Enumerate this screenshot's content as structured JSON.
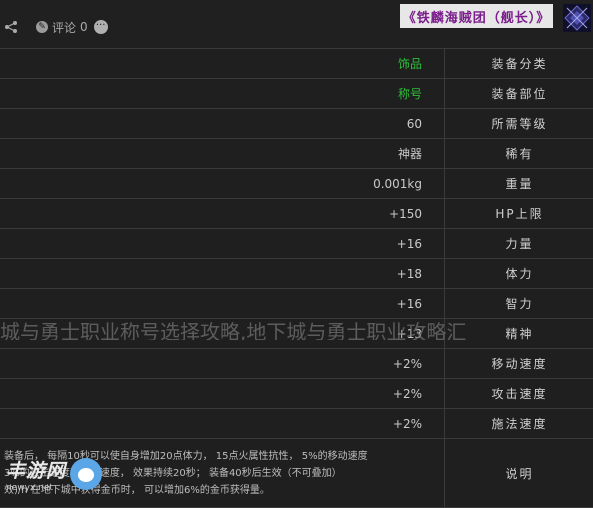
{
  "header": {
    "title": "《铁麟海贼团（舰长）》",
    "comment_label": "评论",
    "comment_count": "0"
  },
  "rows": [
    {
      "label": "装备分类",
      "value": "饰品",
      "value_color": "green"
    },
    {
      "label": "装备部位",
      "value": "称号",
      "value_color": "green"
    },
    {
      "label": "所需等级",
      "value": "60"
    },
    {
      "label": "稀有",
      "value": "神器"
    },
    {
      "label": "重量",
      "value": "0.001kg"
    },
    {
      "label": "HP上限",
      "value": "+150"
    },
    {
      "label": "力量",
      "value": "+16"
    },
    {
      "label": "体力",
      "value": "+18"
    },
    {
      "label": "智力",
      "value": "+16"
    },
    {
      "label": "精神",
      "value": "+13"
    },
    {
      "label": "移动速度",
      "value": "+2%"
    },
    {
      "label": "攻击速度",
      "value": "+2%"
    },
    {
      "label": "施法速度",
      "value": "+2%"
    }
  ],
  "description": {
    "label": "说明",
    "text": "装备后，  每隔10秒可以使自身增加20点体力，  15点火属性抗性，  5%的移动速度\n3%的攻击速度和施放速度，  效果持续20秒；  装备40秒后生效（不可叠加）\n效)/h  在地下城中获得金币时，  可以增加6%的金币获得量。"
  },
  "watermark": "城与勇士职业称号选择攻略,地下城与勇士职业攻略汇",
  "site": {
    "name": "丰游网",
    "url": "newyx.net"
  }
}
